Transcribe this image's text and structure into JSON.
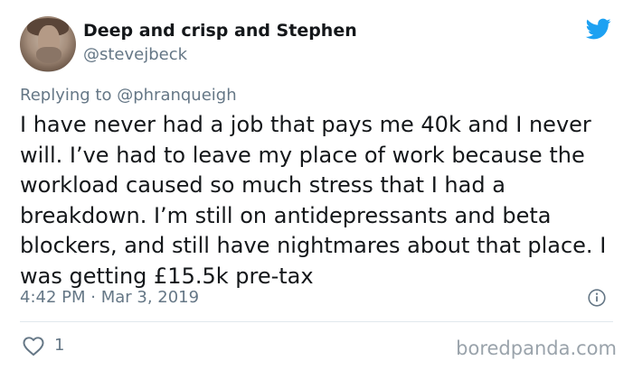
{
  "tweet": {
    "author": {
      "display_name": "Deep and crisp and Stephen",
      "handle": "@stevejbeck"
    },
    "reply": {
      "prefix": "Replying to ",
      "mention": "@phranqueigh"
    },
    "text": "I have never had a job that pays me 40k and I never will. I’ve had to leave my place of work because the workload caused so much stress that I had a breakdown. I’m still on antidepressants and beta blockers, and still have nightmares about that place. I was getting £15.5k pre-tax",
    "timestamp": "4:42 PM · Mar 3, 2019",
    "likes": "1"
  },
  "watermark": "boredpanda.com",
  "icons": {
    "brand": "twitter-bird-icon",
    "info": "info-icon",
    "like": "heart-icon"
  },
  "colors": {
    "twitter_blue": "#1da1f2",
    "secondary_text": "#657786",
    "primary_text": "#14171a",
    "divider": "#e1e8ed"
  }
}
